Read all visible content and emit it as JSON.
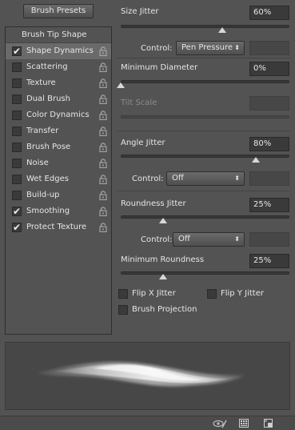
{
  "presets_button": "Brush Presets",
  "tip_shape_label": "Brush Tip Shape",
  "options": [
    {
      "label": "Shape Dynamics",
      "checked": true,
      "selected": true
    },
    {
      "label": "Scattering",
      "checked": false,
      "selected": false
    },
    {
      "label": "Texture",
      "checked": false,
      "selected": false
    },
    {
      "label": "Dual Brush",
      "checked": false,
      "selected": false
    },
    {
      "label": "Color Dynamics",
      "checked": false,
      "selected": false
    },
    {
      "label": "Transfer",
      "checked": false,
      "selected": false
    },
    {
      "label": "Brush Pose",
      "checked": false,
      "selected": false
    },
    {
      "label": "Noise",
      "checked": false,
      "selected": false
    },
    {
      "label": "Wet Edges",
      "checked": false,
      "selected": false
    },
    {
      "label": "Build-up",
      "checked": false,
      "selected": false
    },
    {
      "label": "Smoothing",
      "checked": true,
      "selected": false
    },
    {
      "label": "Protect Texture",
      "checked": true,
      "selected": false
    }
  ],
  "size_jitter": {
    "label": "Size Jitter",
    "value": "60%",
    "level": 0.6
  },
  "size_control": {
    "label": "Control:",
    "value": "Pen Pressure"
  },
  "minimum_diameter": {
    "label": "Minimum Diameter",
    "value": "0%",
    "level": 0.0
  },
  "tilt_scale": {
    "label": "Tilt Scale"
  },
  "angle_jitter": {
    "label": "Angle Jitter",
    "value": "80%",
    "level": 0.8
  },
  "angle_control": {
    "label": "Control:",
    "value": "Off"
  },
  "roundness_jitter": {
    "label": "Roundness Jitter",
    "value": "25%",
    "level": 0.25
  },
  "roundness_control": {
    "label": "Control:",
    "value": "Off"
  },
  "minimum_roundness": {
    "label": "Minimum Roundness",
    "value": "25%",
    "level": 0.25
  },
  "flip_x": {
    "label": "Flip X Jitter",
    "checked": false
  },
  "flip_y": {
    "label": "Flip Y Jitter",
    "checked": false
  },
  "brush_projection": {
    "label": "Brush Projection",
    "checked": false
  },
  "icons": {
    "lock": "lock-icon",
    "dropdown": "chevron-down-icon",
    "toggle_preview": "eye-brush-icon",
    "grid": "grid-icon",
    "new_preset": "new-preset-icon"
  }
}
